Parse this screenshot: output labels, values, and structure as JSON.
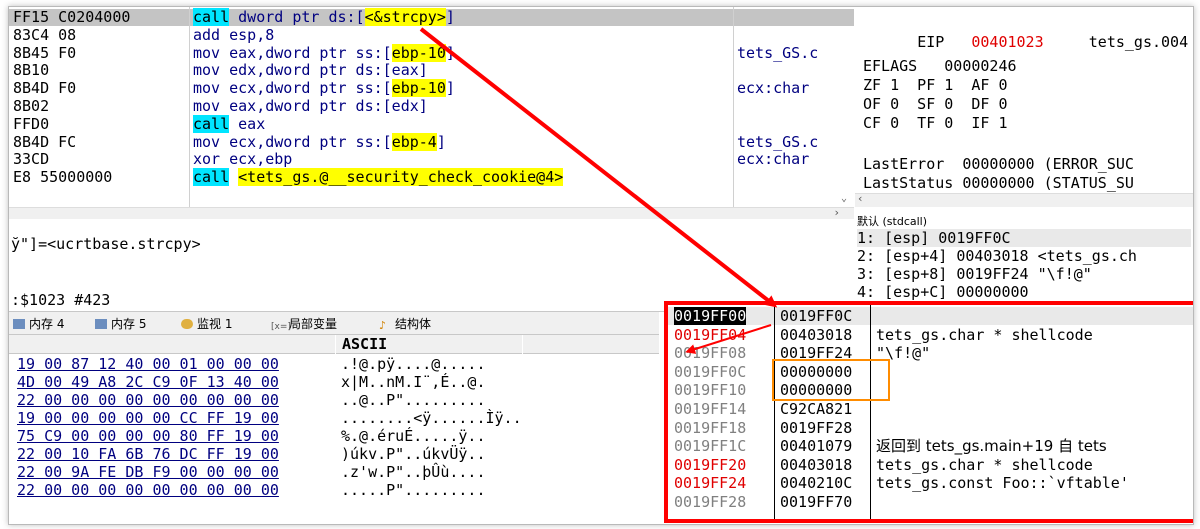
{
  "disasm": {
    "rows": [
      {
        "bytes": "FF15 C0204000",
        "pre": "",
        "kw": "call",
        "mid": " dword ptr ds:[",
        "hl": "<&strcpy>",
        "post": "]",
        "cmt": ""
      },
      {
        "bytes": "83C4 08",
        "pre": "add esp,8",
        "kw": "",
        "mid": "",
        "hl": "",
        "post": "",
        "cmt": ""
      },
      {
        "bytes": "8B45 F0",
        "pre": "mov eax,dword ptr ss:[",
        "kw": "",
        "mid": "",
        "hl": "ebp-10",
        "post": "]",
        "cmt": "tets_GS.c"
      },
      {
        "bytes": "8B10",
        "pre": "mov edx,dword ptr ds:[eax]",
        "kw": "",
        "mid": "",
        "hl": "",
        "post": "",
        "cmt": ""
      },
      {
        "bytes": "8B4D F0",
        "pre": "mov ecx,dword ptr ss:[",
        "kw": "",
        "mid": "",
        "hl": "ebp-10",
        "post": "]",
        "cmt": "ecx:char"
      },
      {
        "bytes": "8B02",
        "pre": "mov eax,dword ptr ds:[edx]",
        "kw": "",
        "mid": "",
        "hl": "",
        "post": "",
        "cmt": ""
      },
      {
        "bytes": "FFD0",
        "pre": "",
        "kw": "call",
        "mid": " eax",
        "hl": "",
        "post": "",
        "cmt": ""
      },
      {
        "bytes": "8B4D FC",
        "pre": "mov ecx,dword ptr ss:[",
        "kw": "",
        "mid": "",
        "hl": "ebp-4",
        "post": "]",
        "cmt": "tets_GS.c"
      },
      {
        "bytes": "33CD",
        "pre": "xor ecx,ebp",
        "kw": "",
        "mid": "",
        "hl": "",
        "post": "",
        "cmt": "ecx:char"
      },
      {
        "bytes": "E8 55000000",
        "pre": "",
        "kw": "call",
        "mid": " ",
        "hl": "<tets_gs.@__security_check_cookie@4>",
        "post": "",
        "cmt": ""
      }
    ]
  },
  "regs": {
    "eip_label": "EIP",
    "eip_value": "00401023",
    "eip_module": "tets_gs.004",
    "eflags_label": "EFLAGS",
    "eflags_value": "00000246",
    "flags_line1": "ZF 1  PF 1  AF 0",
    "flags_line2": "OF 0  SF 0  DF 0",
    "flags_line3": "CF 0  TF 0  IF 1",
    "lasterror": "LastError  00000000 (ERROR_SUC",
    "laststatus": "LastStatus 00000000 (STATUS_SU"
  },
  "info": {
    "line1": "ў\"]=<ucrtbase.strcpy>",
    "line2": ":$1023 #423"
  },
  "args": {
    "header": "默认 (stdcall)",
    "rows": [
      "1: [esp] 0019FF0C",
      "2: [esp+4] 00403018 <tets_gs.ch",
      "3: [esp+8] 0019FF24 \"\\f!@\"",
      "4: [esp+C] 00000000"
    ]
  },
  "tabs": [
    {
      "label": "内存 4",
      "icon": "memory-icon"
    },
    {
      "label": "内存 5",
      "icon": "memory-icon"
    },
    {
      "label": "监视 1",
      "icon": "watch-icon"
    },
    {
      "label": "局部变量",
      "icon": "locals-icon"
    },
    {
      "label": "结构体",
      "icon": "struct-icon"
    }
  ],
  "dump": {
    "ascii_header": "ASCII",
    "rows": [
      {
        "hex": "19 00 87 12 40 00 01 00 00 00",
        "ascii": ".!@.pÿ....@....."
      },
      {
        "hex": "4D 00 49 A8 2C C9 0F 13 40 00",
        "ascii": "x|M..nM.I¨,É..@."
      },
      {
        "hex": "22 00 00 00 00 00 00 00 00 00",
        "ascii": "..@..P\"........."
      },
      {
        "hex": "19 00 00 00 00 00 CC FF 19 00",
        "ascii": "........<ÿ......Ìÿ.."
      },
      {
        "hex": "75 C9 00 00 00 00 80 FF 19 00",
        "ascii": "%.@.éruÉ.....ÿ.."
      },
      {
        "hex": "22 00 10 FA 6B 76 DC FF 19 00",
        "ascii": ")úkv.P\"..úkvÜÿ.."
      },
      {
        "hex": "22 00 9A FE DB F9 00 00 00 00",
        "ascii": ".z'w.P\"..þÛù...."
      },
      {
        "hex": "22 00 00 00 00 00 00 00 00 00",
        "ascii": ".....P\"........."
      }
    ]
  },
  "stack": {
    "rows": [
      {
        "addr": "0019FF00",
        "val": "0019FF0C",
        "cmt": "",
        "cmt_cn": "",
        "addr_red": false
      },
      {
        "addr": "0019FF04",
        "val": "00403018",
        "cmt": "tets_gs.char * shellcode",
        "cmt_cn": "",
        "addr_red": true
      },
      {
        "addr": "0019FF08",
        "val": "0019FF24",
        "cmt": "\"\\f!@\"",
        "cmt_cn": "",
        "addr_red": false
      },
      {
        "addr": "0019FF0C",
        "val": "00000000",
        "cmt": "",
        "cmt_cn": "",
        "addr_red": false
      },
      {
        "addr": "0019FF10",
        "val": "00000000",
        "cmt": "",
        "cmt_cn": "",
        "addr_red": false
      },
      {
        "addr": "0019FF14",
        "val": "C92CA821",
        "cmt": "",
        "cmt_cn": "",
        "addr_red": false
      },
      {
        "addr": "0019FF18",
        "val": "0019FF28",
        "cmt": "",
        "cmt_cn": "",
        "addr_red": false
      },
      {
        "addr": "0019FF1C",
        "val": "00401079",
        "cmt": "",
        "cmt_cn": "返回到 tets_gs.main+19 自 tets",
        "addr_red": false
      },
      {
        "addr": "0019FF20",
        "val": "00403018",
        "cmt": "tets_gs.char * shellcode",
        "cmt_cn": "",
        "addr_red": true
      },
      {
        "addr": "0019FF24",
        "val": "0040210C",
        "cmt": "tets_gs.const Foo::`vftable'",
        "cmt_cn": "",
        "addr_red": true
      },
      {
        "addr": "0019FF28",
        "val": "0019FF70",
        "cmt": "",
        "cmt_cn": "",
        "addr_red": false
      }
    ]
  },
  "colors": {
    "annotation": "#ff0000",
    "orange": "#ff8c00",
    "call_bg": "#00e5ff",
    "highlight": "#ffff00"
  }
}
